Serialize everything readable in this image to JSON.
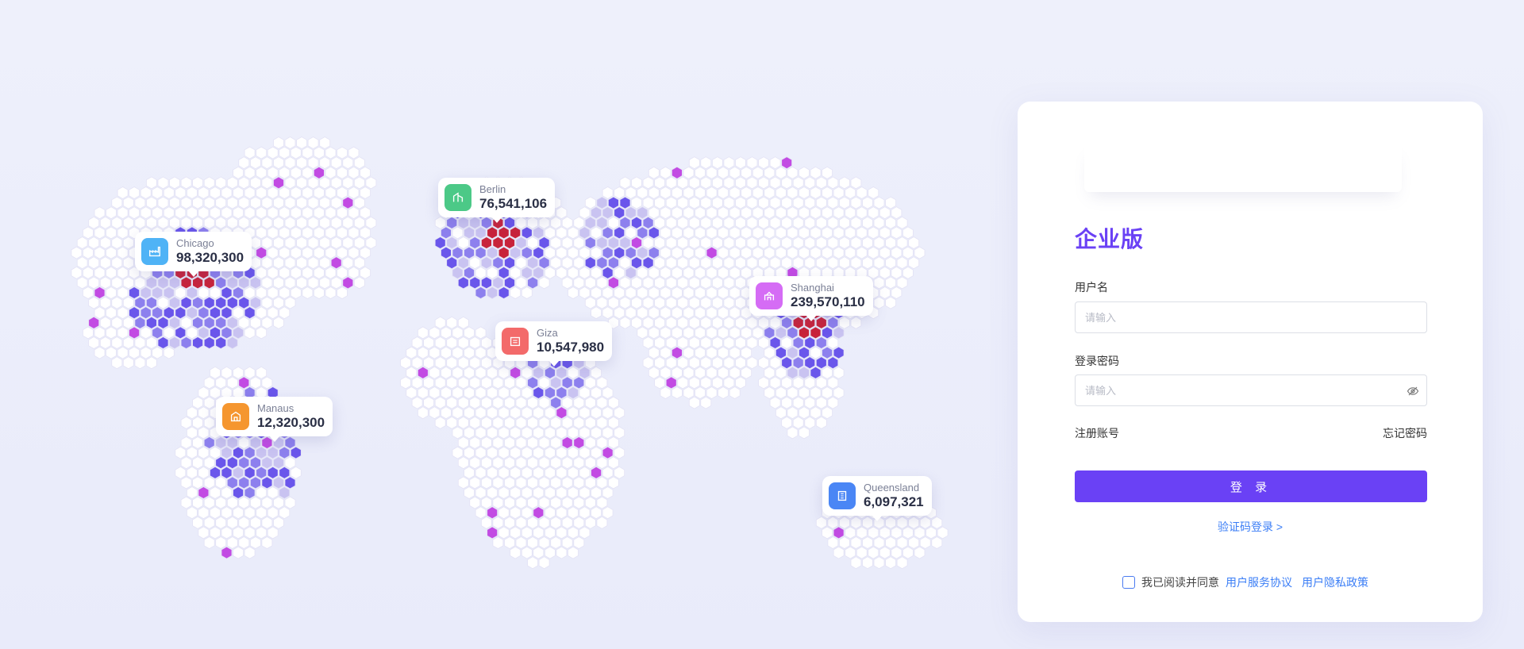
{
  "map": {
    "pins": [
      {
        "city": "Chicago",
        "value": "98,320,300",
        "icon": "factory-icon",
        "color": "#4fb3f6"
      },
      {
        "city": "Berlin",
        "value": "76,541,106",
        "icon": "building-icon",
        "color": "#4cc987"
      },
      {
        "city": "Giza",
        "value": "10,547,980",
        "icon": "pyramid-icon",
        "color": "#f36a6a"
      },
      {
        "city": "Shanghai",
        "value": "239,570,110",
        "icon": "tower-icon",
        "color": "#d56cf5"
      },
      {
        "city": "Manaus",
        "value": "12,320,300",
        "icon": "house-icon",
        "color": "#f5962f"
      },
      {
        "city": "Queensland",
        "value": "6,097,321",
        "icon": "office-icon",
        "color": "#4a86f5"
      }
    ]
  },
  "login": {
    "edition": "企业版",
    "username_label": "用户名",
    "username_placeholder": "请输入",
    "password_label": "登录密码",
    "password_placeholder": "请输入",
    "register_link": "注册账号",
    "forgot_link": "忘记密码",
    "login_button": "登 录",
    "sms_login": "验证码登录  >",
    "agree_text": "我已阅读并同意",
    "service_agreement": "用户服务协议",
    "privacy_policy": "用户隐私政策"
  },
  "colors": {
    "accent": "#6a41f5",
    "link": "#3b7ef6",
    "hex_base": "#ffffff",
    "hex_light": "#c9c3f1",
    "hex_mid": "#8d80ee",
    "hex_strong": "#6a56eb",
    "hex_hot": "#c8233b",
    "hex_pink": "#c24be3"
  }
}
